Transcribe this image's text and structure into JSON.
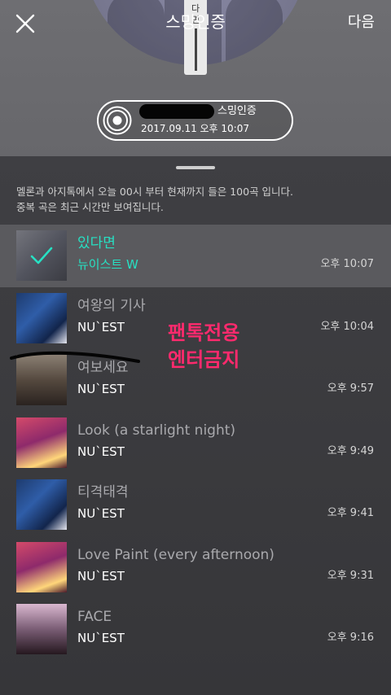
{
  "header": {
    "title": "스밍인증",
    "next_label": "다음",
    "cover_text": "다\n면"
  },
  "certificate": {
    "label": "스밍인증",
    "date": "2017.09.11 오후 10:07"
  },
  "notice": {
    "line1": "멜론과 아지톡에서 오늘 00시 부터 현재까지 들은 100곡 입니다.",
    "line2": "중복 곡은 최근 시간만 보여집니다."
  },
  "songs": [
    {
      "title": "있다면",
      "artist": "뉴이스트 W",
      "time": "오후 10:07",
      "selected": true
    },
    {
      "title": "여왕의 기사",
      "artist": "NU`EST",
      "time": "오후 10:04",
      "selected": false
    },
    {
      "title": "여보세요",
      "artist": "NU`EST",
      "time": "오후 9:57",
      "selected": false
    },
    {
      "title": "Look (a starlight night)",
      "artist": "NU`EST",
      "time": "오후 9:49",
      "selected": false
    },
    {
      "title": "티격태격",
      "artist": "NU`EST",
      "time": "오후 9:41",
      "selected": false
    },
    {
      "title": "Love Paint (every afternoon)",
      "artist": "NU`EST",
      "time": "오후 9:31",
      "selected": false
    },
    {
      "title": "FACE",
      "artist": "NU`EST",
      "time": "오후 9:16",
      "selected": false
    }
  ],
  "stamp": {
    "line1": "팬톡전용",
    "line2": "엔터금지"
  },
  "colors": {
    "accent": "#27e0c3",
    "stamp": "#ff2a6d",
    "sheet": "#3a3a3d"
  },
  "icons": {
    "close": "close-icon",
    "disc": "disc-icon",
    "check": "check-icon"
  }
}
